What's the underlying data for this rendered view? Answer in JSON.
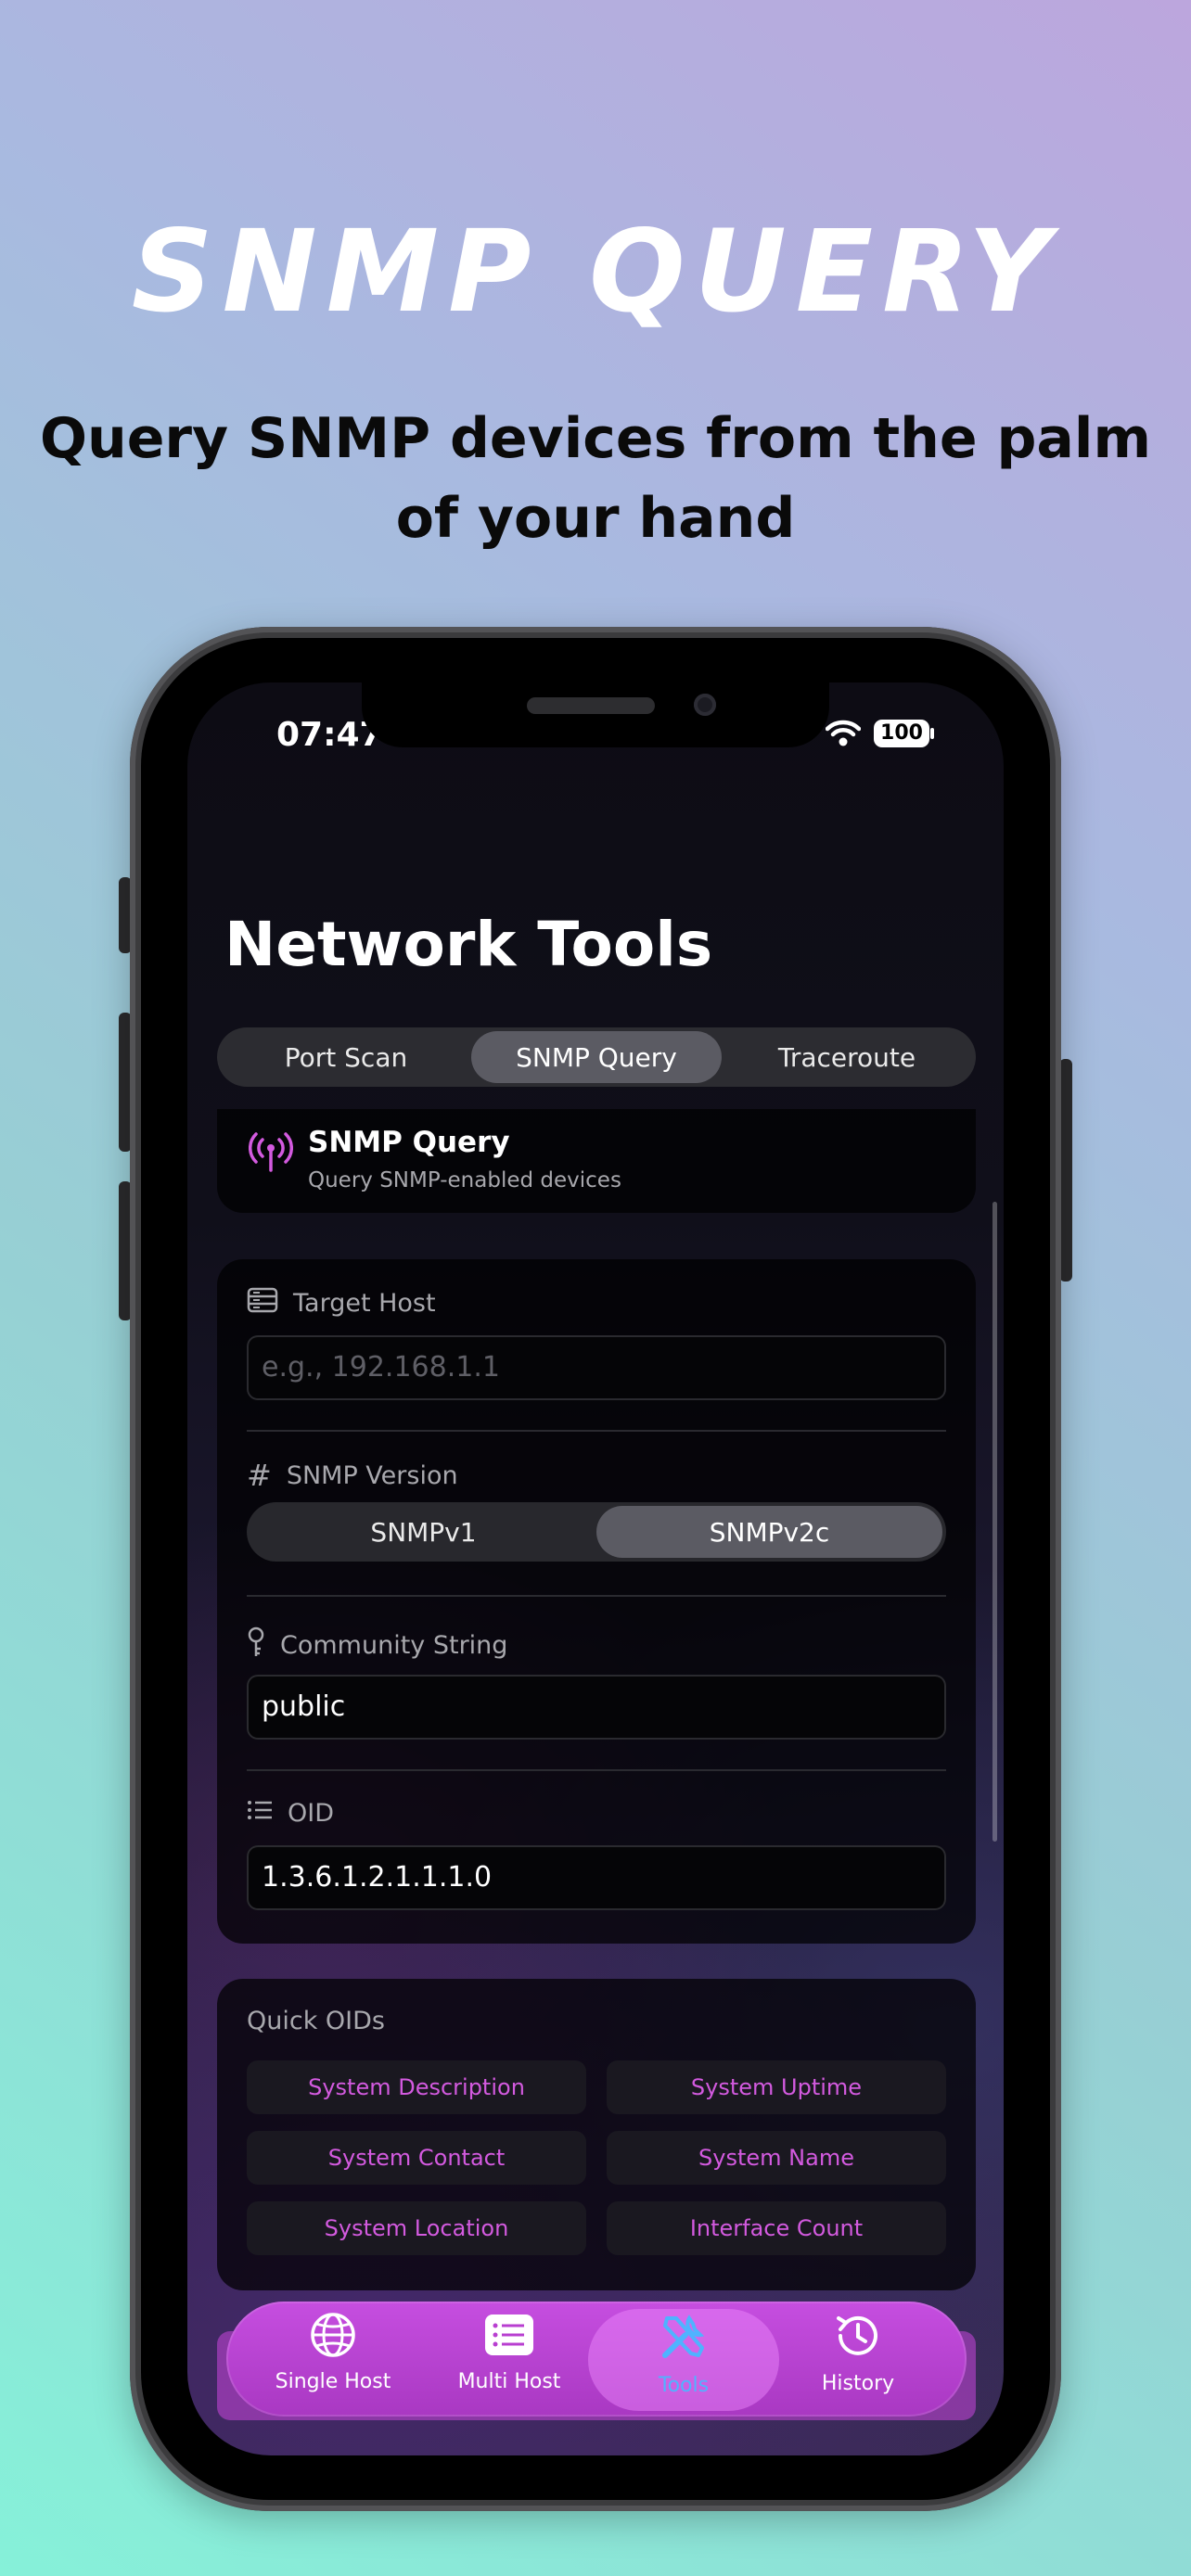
{
  "hero": {
    "title": "SNMP QUERY",
    "subtitle": "Query SNMP devices from the palm of your hand"
  },
  "status_bar": {
    "time": "07:47",
    "battery": "100",
    "icons": [
      "wifi-icon",
      "battery-icon"
    ]
  },
  "nav": {
    "large_title": "Network Tools"
  },
  "segments": {
    "items": [
      "Port Scan",
      "SNMP Query",
      "Traceroute"
    ],
    "selected": "SNMP Query"
  },
  "header_card": {
    "icon": "antenna-icon",
    "title": "SNMP Query",
    "subtitle": "Query SNMP-enabled devices"
  },
  "form": {
    "target_host": {
      "label": "Target Host",
      "icon": "server-icon",
      "value": "",
      "placeholder": "e.g., 192.168.1.1"
    },
    "snmp_version": {
      "label": "SNMP Version",
      "icon": "hash-icon",
      "options": [
        "SNMPv1",
        "SNMPv2c"
      ],
      "selected": "SNMPv2c"
    },
    "community": {
      "label": "Community String",
      "icon": "key-icon",
      "value": "public"
    },
    "oid": {
      "label": "OID",
      "icon": "list-icon",
      "value": "1.3.6.1.2.1.1.1.0"
    }
  },
  "quick_oids": {
    "title": "Quick OIDs",
    "items": [
      "System Description",
      "System Uptime",
      "System Contact",
      "System Name",
      "System Location",
      "Interface Count"
    ]
  },
  "tab_bar": {
    "items": [
      {
        "label": "Single Host",
        "icon": "globe-icon"
      },
      {
        "label": "Multi Host",
        "icon": "list-icon"
      },
      {
        "label": "Tools",
        "icon": "tools-icon"
      },
      {
        "label": "History",
        "icon": "history-icon"
      }
    ],
    "selected": "Tools"
  },
  "colors": {
    "accent": "#d35adf",
    "tab_bar": "#bd45d6",
    "selected_tab_label": "#4fb3ff"
  }
}
